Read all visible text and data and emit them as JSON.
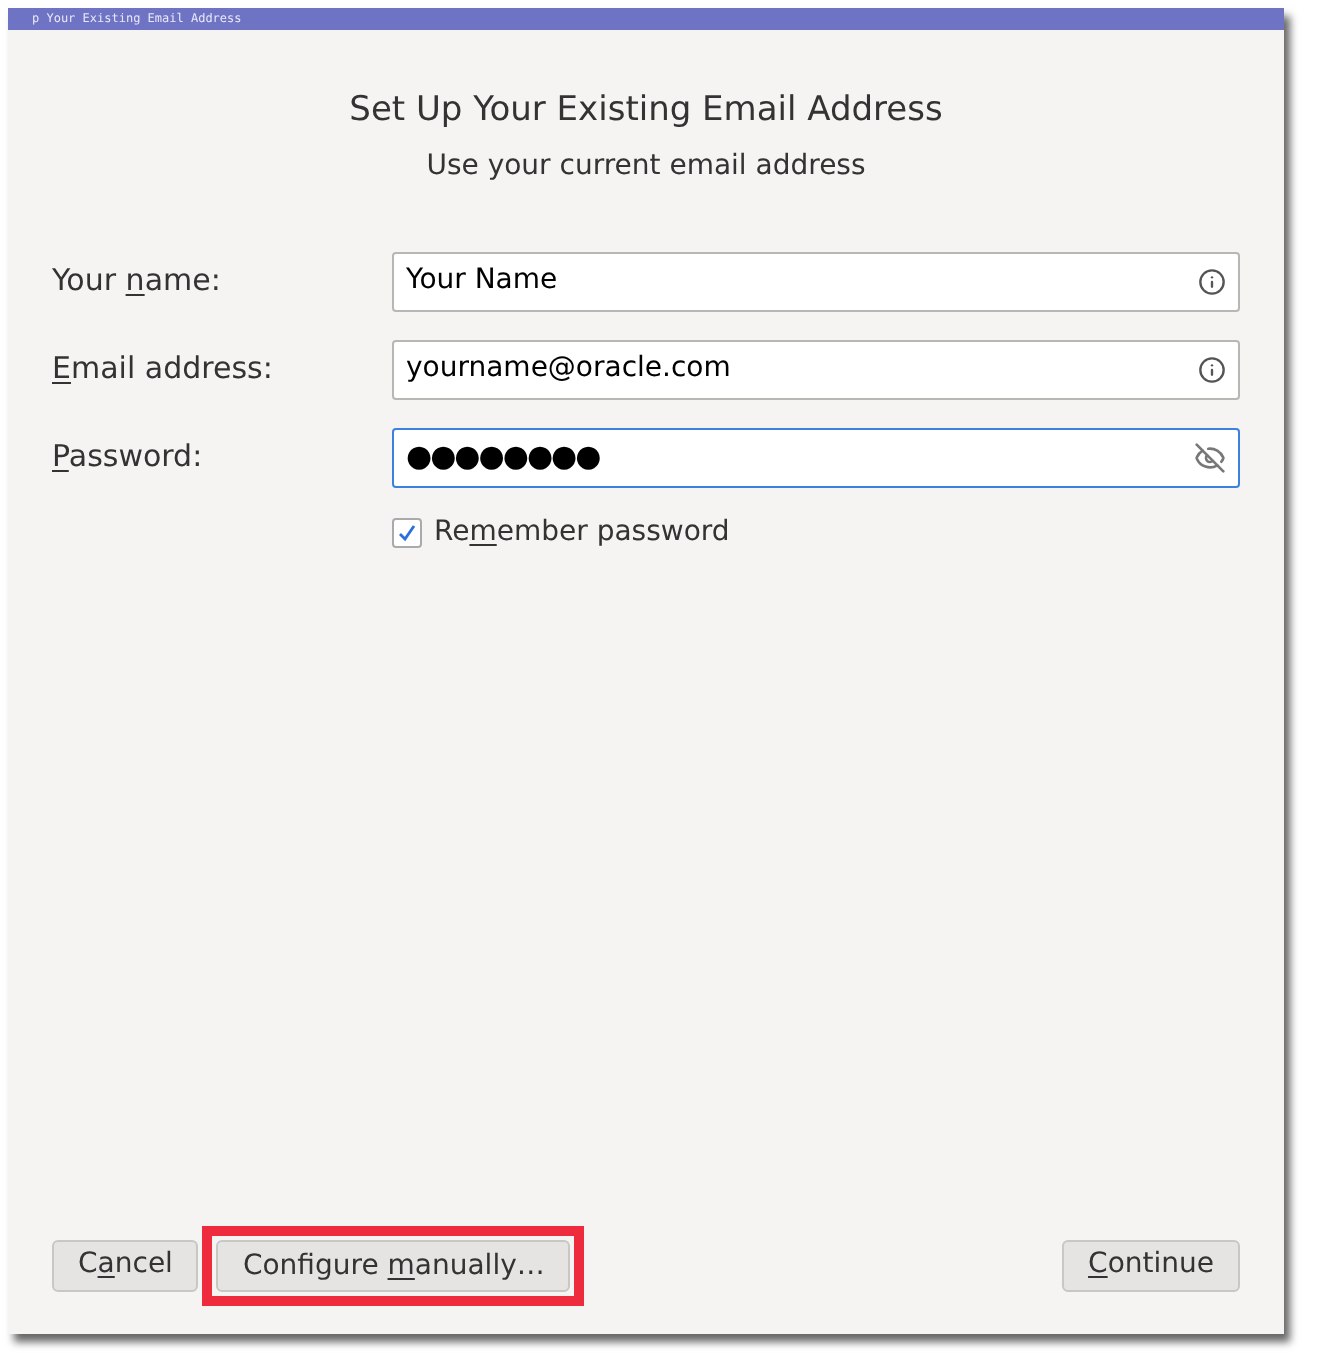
{
  "window": {
    "title": "p Your Existing Email Address"
  },
  "heading": "Set Up Your Existing Email Address",
  "subheading": "Use your current email address",
  "fields": [
    {
      "label": [
        {
          "text": "Your "
        },
        {
          "text": "n",
          "underlined": true
        },
        {
          "text": "ame:"
        }
      ],
      "value": "Your Name",
      "kind": "info",
      "focused": false
    },
    {
      "label": [
        {
          "text": "E",
          "underlined": true
        },
        {
          "text": "mail address:"
        }
      ],
      "value": "yourname@oracle.com",
      "kind": "info",
      "focused": false
    },
    {
      "label": [
        {
          "text": "P",
          "underlined": true
        },
        {
          "text": "assword:"
        }
      ],
      "value": "●●●●●●●●",
      "kind": "password",
      "focused": true
    }
  ],
  "remember": {
    "label": [
      {
        "text": "Re"
      },
      {
        "text": "m",
        "underlined": true
      },
      {
        "text": "ember password"
      }
    ],
    "checked": true
  },
  "buttons": [
    {
      "label": [
        {
          "text": "C"
        },
        {
          "text": "a",
          "underlined": true
        },
        {
          "text": "ncel"
        }
      ],
      "highlighted": false
    },
    {
      "label": [
        {
          "text": "Configure "
        },
        {
          "text": "m",
          "underlined": true
        },
        {
          "text": "anually…"
        }
      ],
      "highlighted": true
    },
    {
      "label": [
        {
          "text": "C",
          "underlined": true
        },
        {
          "text": "ontinue"
        }
      ],
      "highlighted": false
    }
  ]
}
